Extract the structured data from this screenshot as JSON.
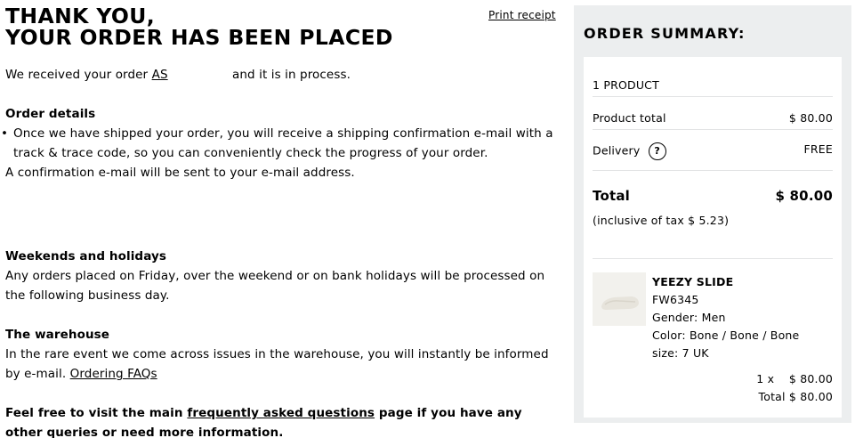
{
  "header": {
    "line1": "THANK YOU,",
    "line2": "YOUR ORDER HAS BEEN PLACED",
    "print_label": "Print receipt"
  },
  "intro": {
    "before": "We received your order",
    "order_prefix": "AS",
    "after": "and it is in process."
  },
  "order_details": {
    "title": "Order details",
    "bullet": "Once we have shipped your order, you will receive a shipping confirmation e-mail with a track & trace code, so you can conveniently check the progress of your order.",
    "note": "A confirmation e-mail will be sent to your e-mail address."
  },
  "weekends": {
    "title": "Weekends and holidays",
    "text": "Any orders placed on Friday, over the weekend or on bank holidays will be processed on the following business day."
  },
  "warehouse": {
    "title": "The warehouse",
    "text": "In the rare event we come across issues in the warehouse, you will instantly be informed by e-mail.",
    "link": "Ordering FAQs"
  },
  "faq": {
    "before": "Feel free to visit the main",
    "link": "frequently asked questions",
    "after": "page if you have any other queries or need more information."
  },
  "summary": {
    "title": "ORDER SUMMARY:",
    "count": "1 PRODUCT",
    "product_total_label": "Product total",
    "product_total_value": "$ 80.00",
    "delivery_label": "Delivery",
    "delivery_help": "?",
    "delivery_value": "FREE",
    "total_label": "Total",
    "total_value": "$ 80.00",
    "tax_note": "(inclusive of tax $ 5.23)"
  },
  "product": {
    "name": "YEEZY SLIDE",
    "code": "FW6345",
    "gender": "Gender: Men",
    "color": "Color: Bone / Bone / Bone",
    "size": "size: 7 UK",
    "qty_line": "1 x    $ 80.00",
    "total_line": "Total $ 80.00"
  }
}
